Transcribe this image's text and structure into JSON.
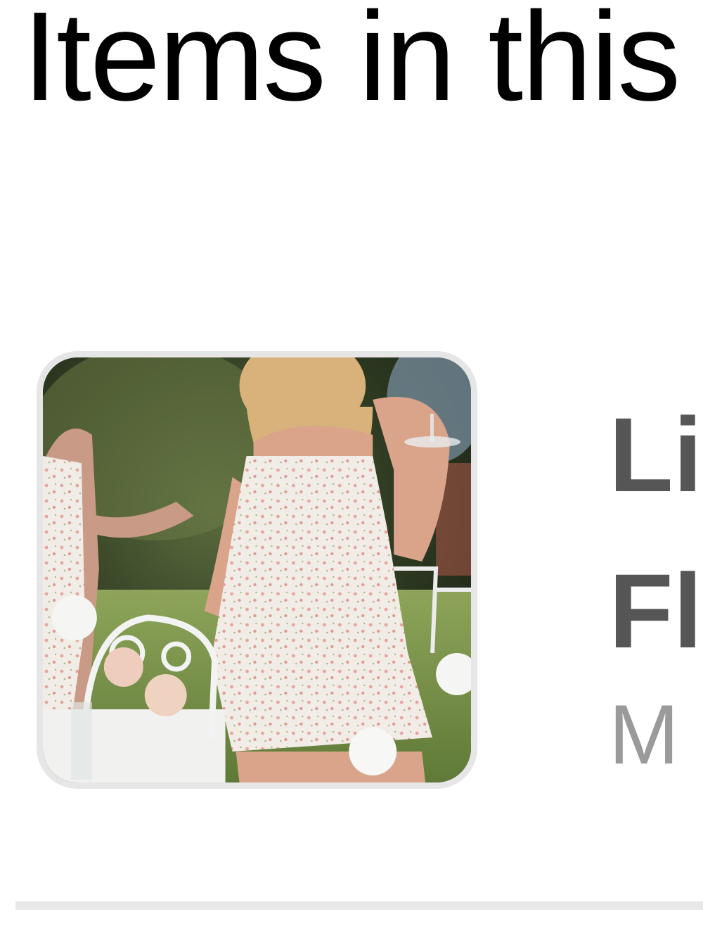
{
  "section": {
    "heading": "Items in this"
  },
  "item": {
    "name_line1": "Li",
    "name_line2": "Fl",
    "size": "M",
    "image_alt": "product-photo-floral-dress"
  }
}
